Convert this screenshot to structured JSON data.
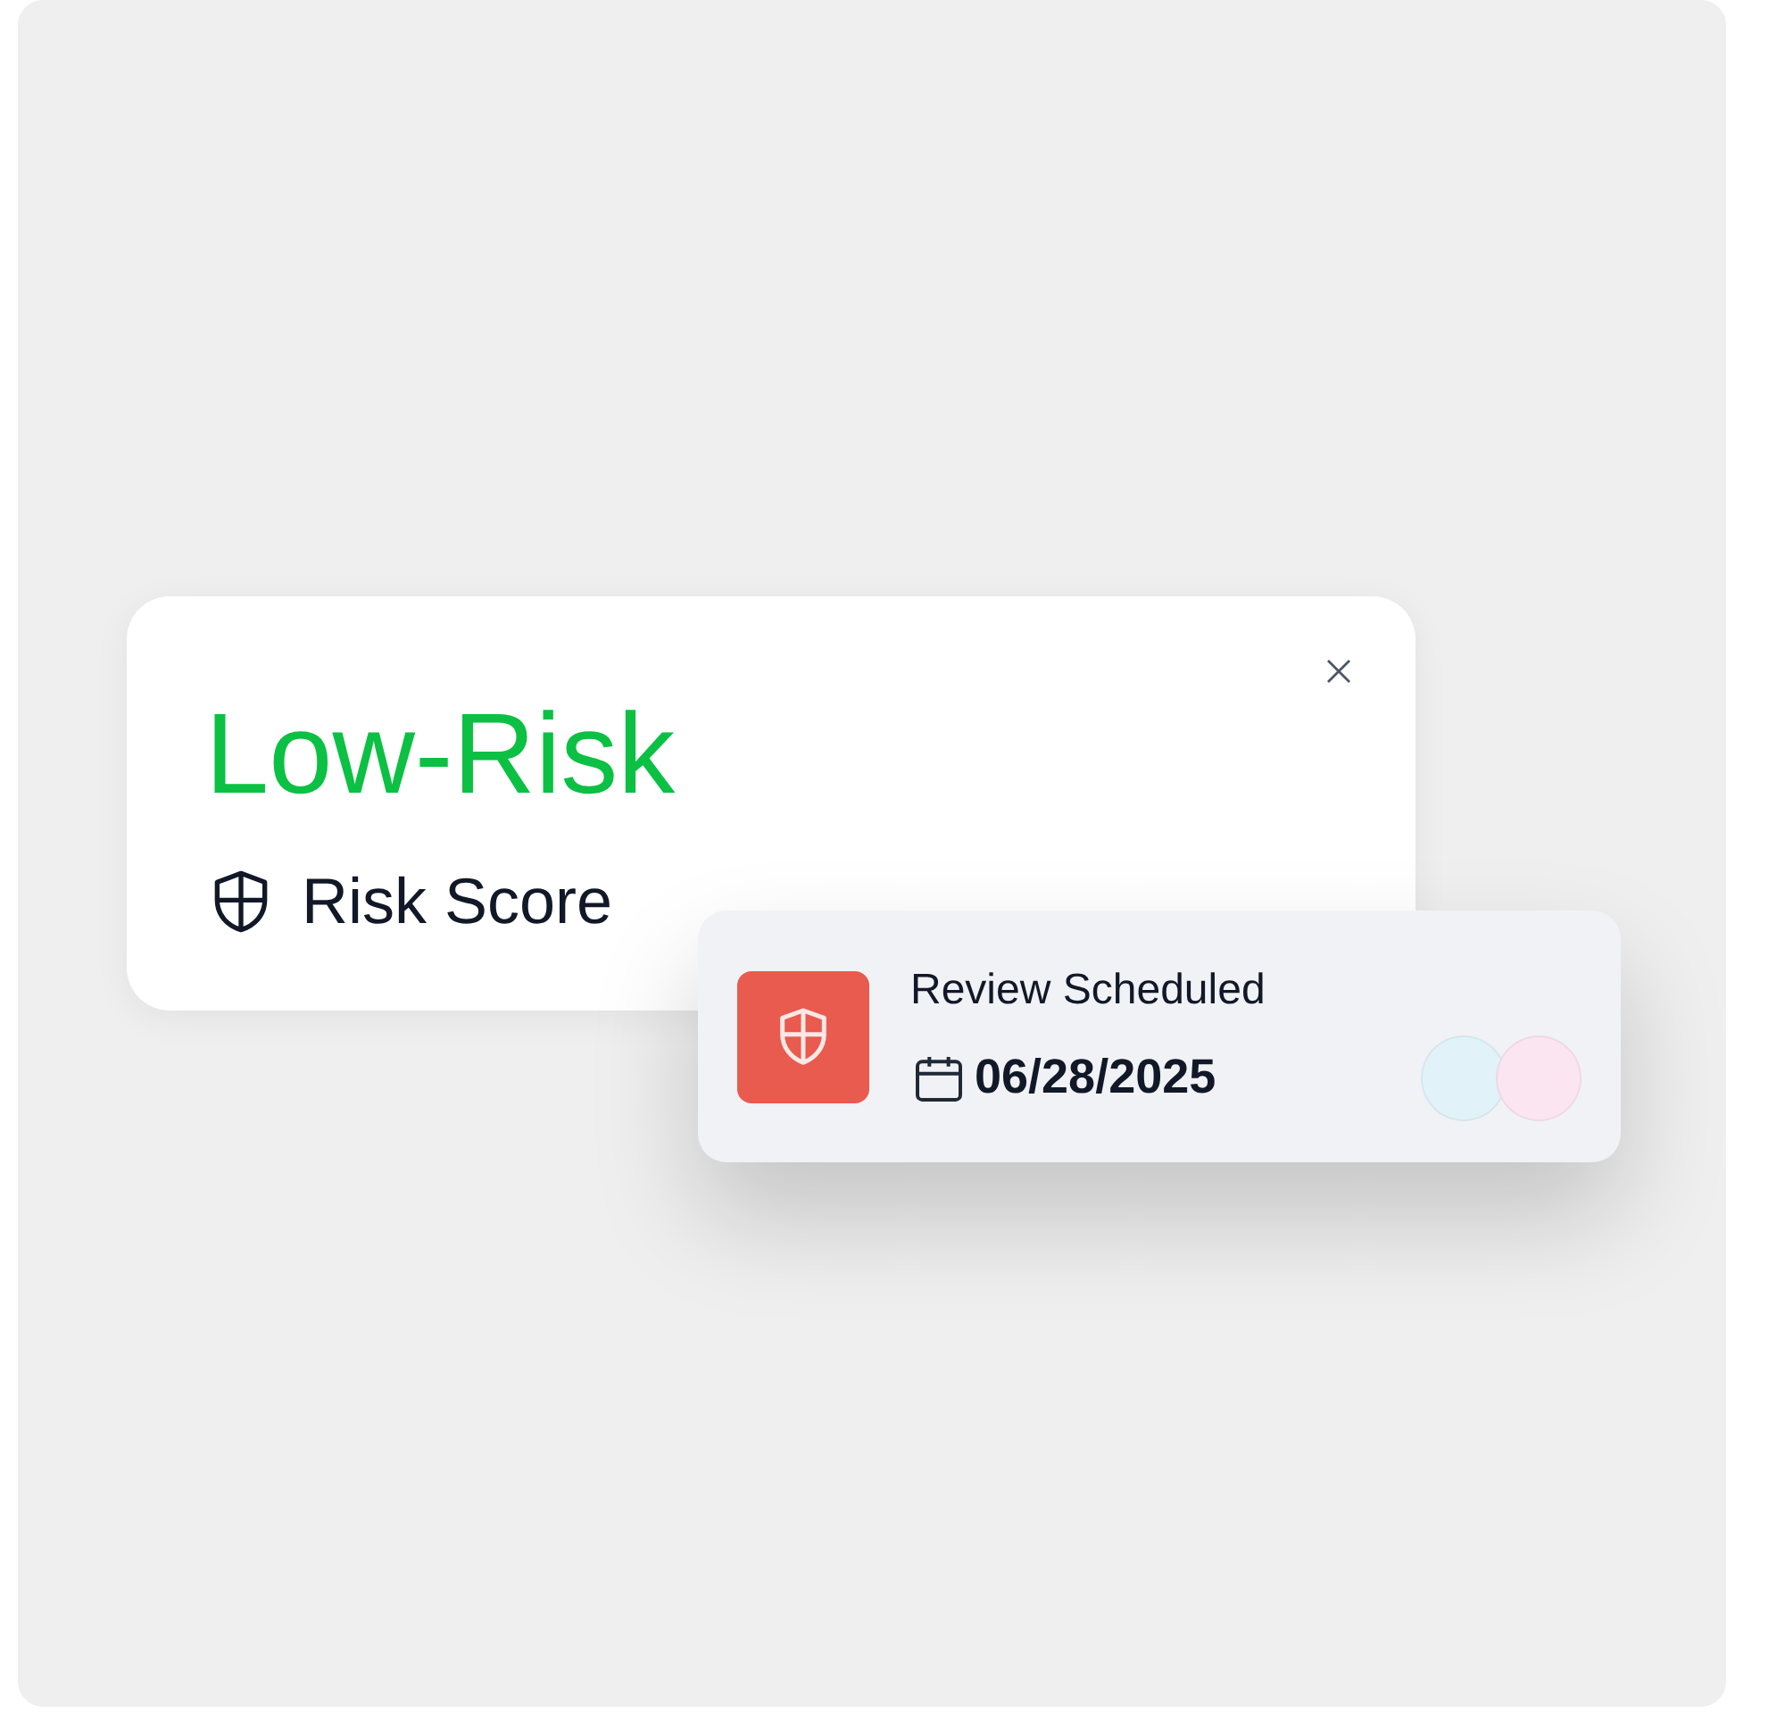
{
  "risk_card": {
    "level_label": "Low-Risk",
    "caption": "Risk Score"
  },
  "review_card": {
    "title": "Review Scheduled",
    "date": "06/28/2025",
    "avatars": [
      {
        "color": "#e1f3f9"
      },
      {
        "color": "#fbe5f1"
      }
    ]
  }
}
